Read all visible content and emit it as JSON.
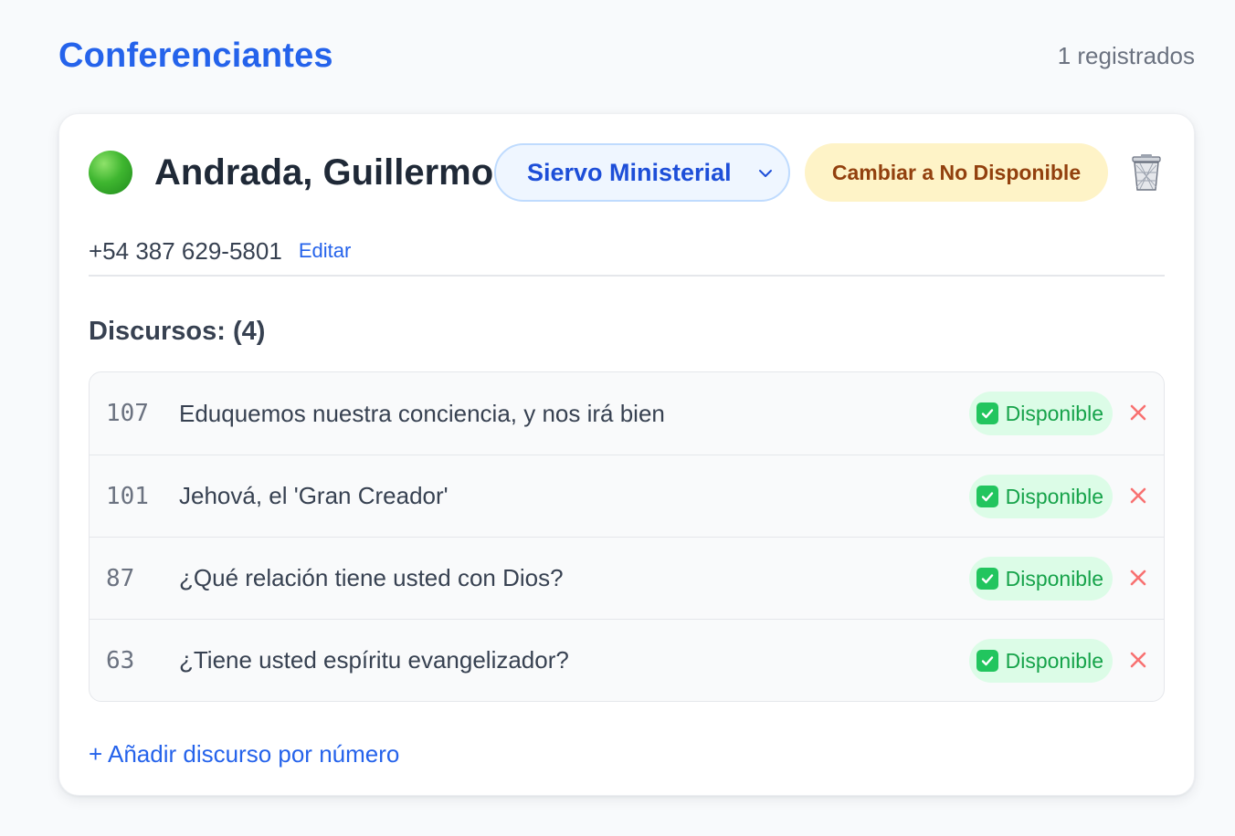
{
  "header": {
    "title": "Conferenciantes",
    "count_text": "1 registrados"
  },
  "speaker": {
    "status_icon": "green-circle",
    "status_color": "#22c55e",
    "name": "Andrada, Guillermo",
    "role": {
      "selected": "Siervo Ministerial"
    },
    "toggle_label": "Cambiar a No Disponible",
    "delete_icon": "trash-icon",
    "phone": "+54 387 629-5801",
    "edit_label": "Editar"
  },
  "talks": {
    "heading": "Discursos: (4)",
    "items": [
      {
        "number": "107",
        "title": "Eduquemos nuestra conciencia, y nos irá bien",
        "status": "Disponible"
      },
      {
        "number": "101",
        "title": "Jehová, el 'Gran Creador'",
        "status": "Disponible"
      },
      {
        "number": "87",
        "title": "¿Qué relación tiene usted con Dios?",
        "status": "Disponible"
      },
      {
        "number": "63",
        "title": "¿Tiene usted espíritu evangelizador?",
        "status": "Disponible"
      }
    ],
    "add_label": "+ Añadir discurso por número"
  },
  "colors": {
    "accent": "#2563eb",
    "available_bg": "#dcfce7",
    "available_text": "#16a34a",
    "warning_bg": "#fef3c7",
    "warning_text": "#92400e",
    "remove": "#f87171"
  }
}
